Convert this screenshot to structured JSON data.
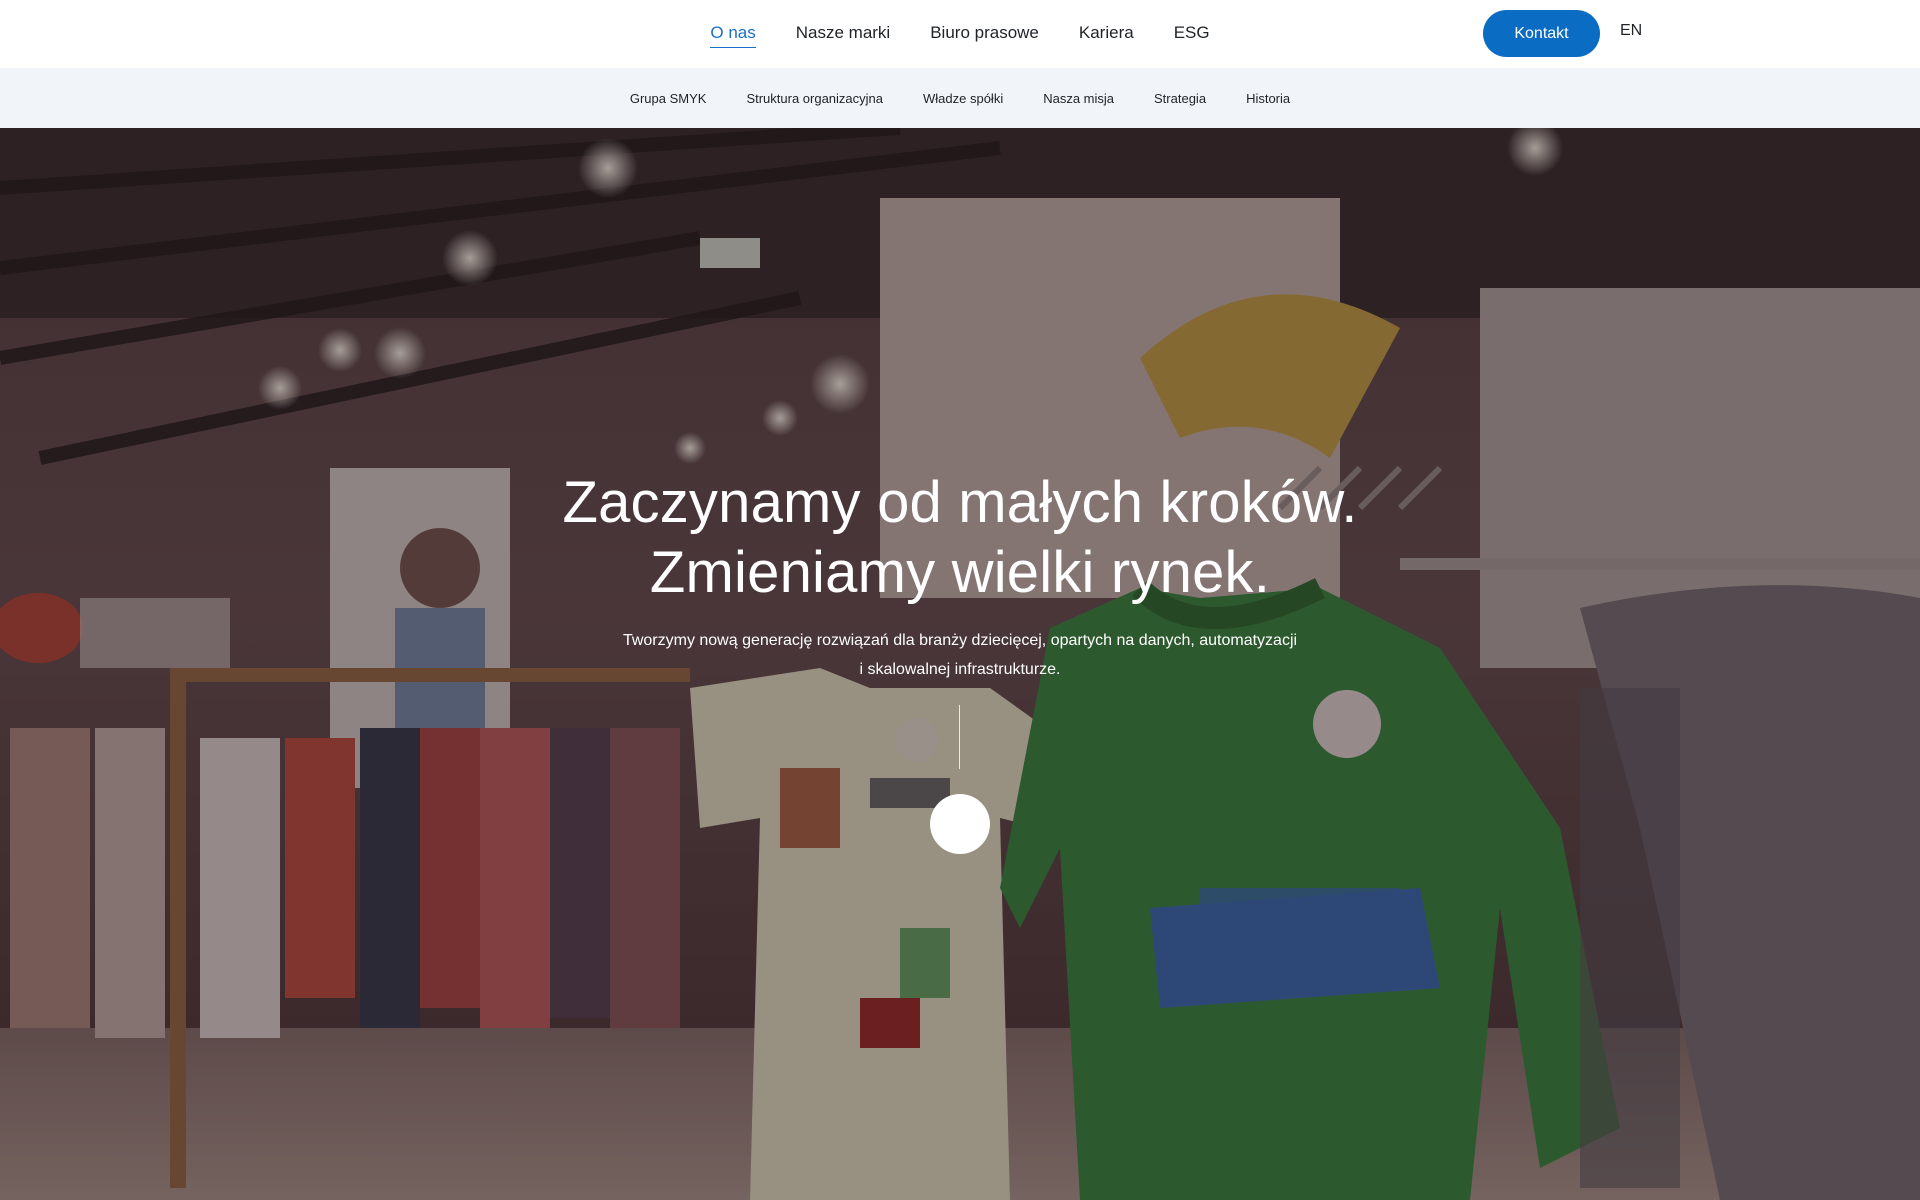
{
  "nav": {
    "items": [
      {
        "label": "O nas",
        "active": true
      },
      {
        "label": "Nasze marki",
        "active": false
      },
      {
        "label": "Biuro prasowe",
        "active": false
      },
      {
        "label": "Kariera",
        "active": false
      },
      {
        "label": "ESG",
        "active": false
      }
    ],
    "contact_label": "Kontakt",
    "lang_label": "EN"
  },
  "subnav": {
    "items": [
      {
        "label": "Grupa SMYK"
      },
      {
        "label": "Struktura organizacyjna"
      },
      {
        "label": "Władze spółki"
      },
      {
        "label": "Nasza misja"
      },
      {
        "label": "Strategia"
      },
      {
        "label": "Historia"
      }
    ]
  },
  "hero": {
    "title_line1": "Zaczynamy od małych kroków.",
    "title_line2": "Zmieniamy wielki rynek.",
    "subtitle_line1": "Tworzymy nową generację rozwiązań dla branży dziecięcej, opartych na danych, automatyzacji",
    "subtitle_line2": "i skalowalnej infrastrukturze."
  },
  "colors": {
    "accent": "#0b6cc4",
    "active_link": "#1a6fc9",
    "subnav_bg": "#f1f5f9",
    "hero_overlay": "#140a0c"
  }
}
